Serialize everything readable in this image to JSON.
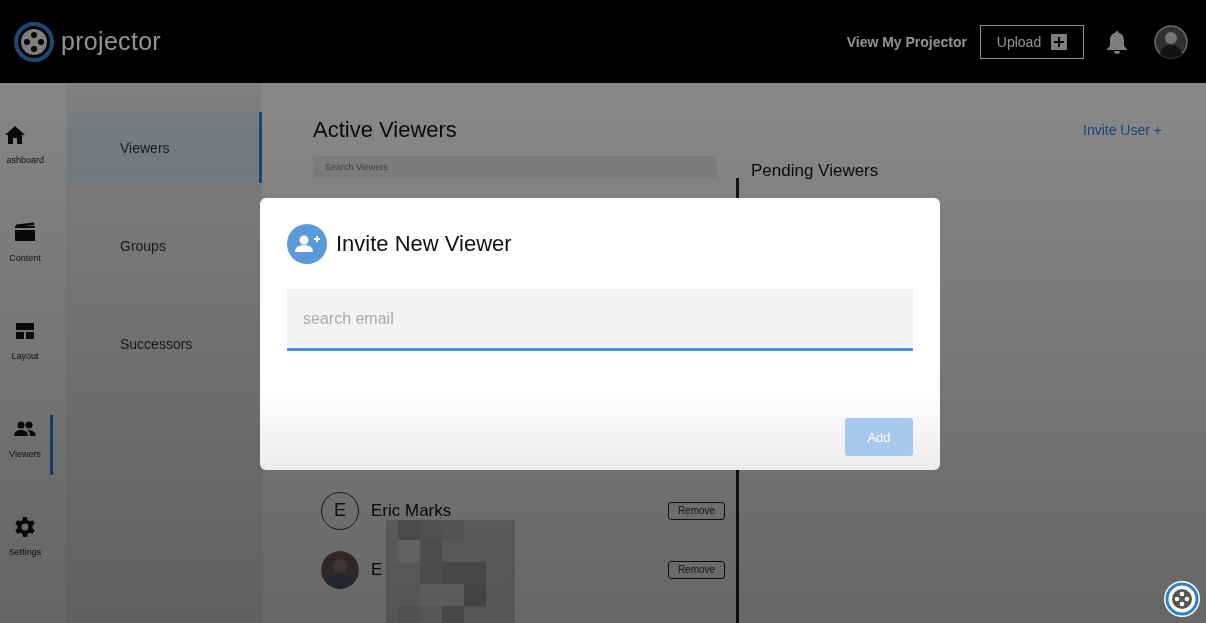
{
  "header": {
    "logo": "projector",
    "link": "View My Projector",
    "upload_button": "Upload"
  },
  "nav": [
    {
      "label": "ashboard",
      "kind": "home",
      "selected": false
    },
    {
      "label": "Content",
      "kind": "film",
      "selected": false
    },
    {
      "label": "Layout",
      "kind": "layout",
      "selected": false
    },
    {
      "label": "Viewers",
      "kind": "people",
      "selected": true
    },
    {
      "label": "Settings",
      "kind": "gear",
      "selected": false
    }
  ],
  "submenu": [
    {
      "label": "Viewers",
      "selected": true
    },
    {
      "label": "Groups",
      "selected": false
    },
    {
      "label": "Successors",
      "selected": false
    }
  ],
  "main": {
    "title": "Active Viewers",
    "invite_link": "Invite User +",
    "search": {
      "placeholder": "Search Viewers"
    },
    "pending_title": "Pending Viewers",
    "rows": [
      {
        "kind": "letter",
        "initial": "E",
        "name": "Eric Marks",
        "action": "Remove"
      },
      {
        "name": "E",
        "action": "Remove"
      }
    ]
  },
  "dialog": {
    "title": "Invite New Viewer",
    "field": {
      "placeholder": "search email"
    },
    "button": {
      "label": "Add",
      "disabled": true
    }
  }
}
